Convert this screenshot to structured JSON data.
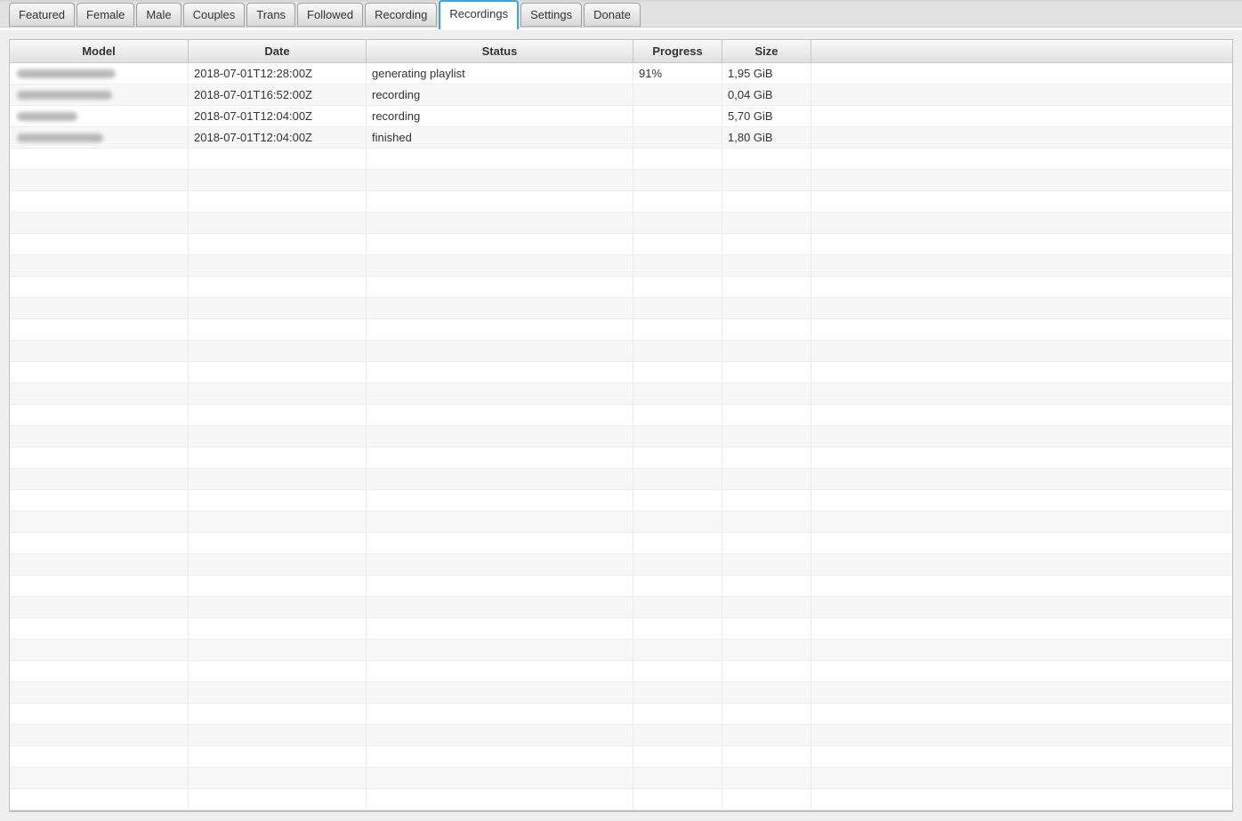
{
  "tabs": {
    "items": [
      {
        "label": "Featured",
        "active": false
      },
      {
        "label": "Female",
        "active": false
      },
      {
        "label": "Male",
        "active": false
      },
      {
        "label": "Couples",
        "active": false
      },
      {
        "label": "Trans",
        "active": false
      },
      {
        "label": "Followed",
        "active": false
      },
      {
        "label": "Recording",
        "active": false
      },
      {
        "label": "Recordings",
        "active": true
      },
      {
        "label": "Settings",
        "active": false
      },
      {
        "label": "Donate",
        "active": false
      }
    ]
  },
  "table": {
    "columns": [
      "Model",
      "Date",
      "Status",
      "Progress",
      "Size"
    ],
    "rows": [
      {
        "model": "",
        "model_redacted": true,
        "blob_width": 111,
        "date": "2018-07-01T12:28:00Z",
        "status": "generating playlist",
        "progress": "91%",
        "size": "1,95 GiB"
      },
      {
        "model": "",
        "model_redacted": true,
        "blob_width": 107,
        "date": "2018-07-01T16:52:00Z",
        "status": "recording",
        "progress": "",
        "size": "0,04 GiB"
      },
      {
        "model": "",
        "model_redacted": true,
        "blob_width": 68,
        "date": "2018-07-01T12:04:00Z",
        "status": "recording",
        "progress": "",
        "size": "5,70 GiB"
      },
      {
        "model": "",
        "model_redacted": true,
        "blob_width": 97,
        "date": "2018-07-01T12:04:00Z",
        "status": "finished",
        "progress": "",
        "size": "1,80 GiB"
      }
    ],
    "empty_row_count": 31
  },
  "colors": {
    "active_tab_border": "#3fa4d8",
    "row_stripe": "#f7f7f7",
    "text": "#333333"
  }
}
